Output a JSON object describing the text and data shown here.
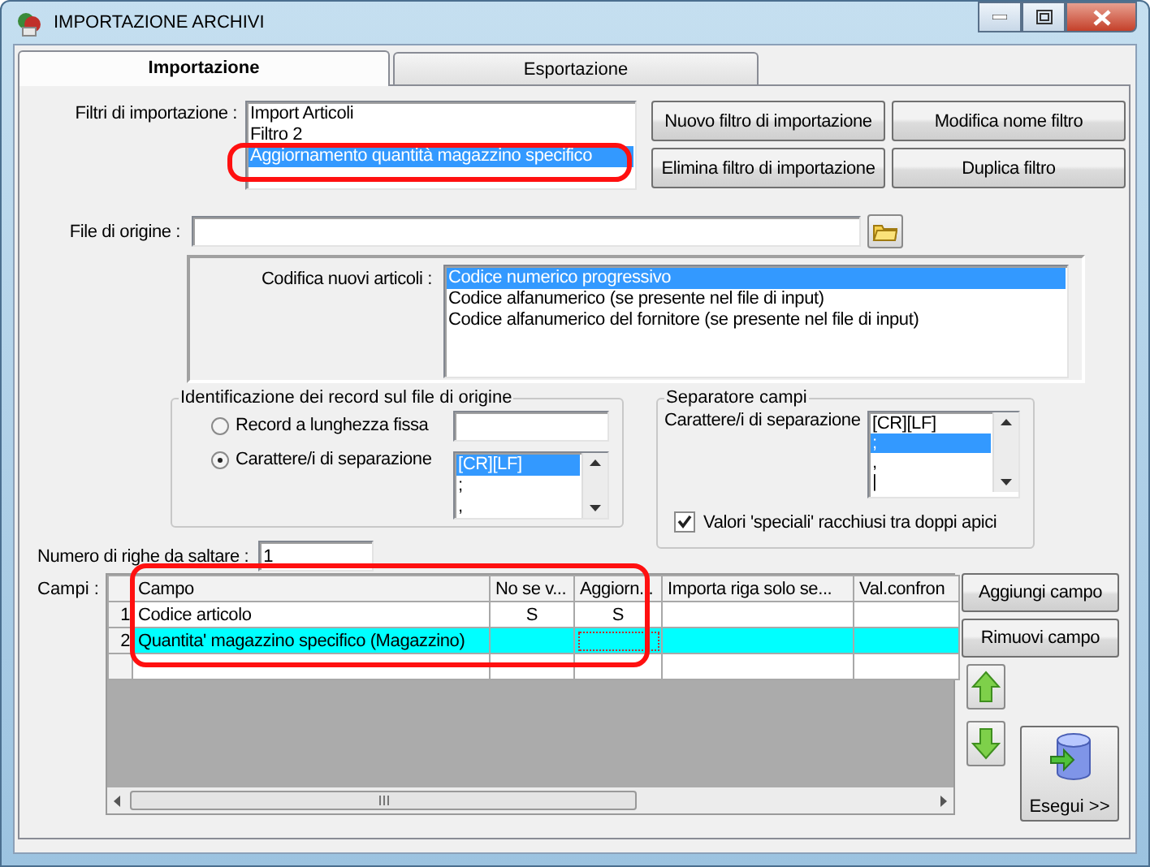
{
  "window": {
    "title": "IMPORTAZIONE ARCHIVI"
  },
  "tabs": [
    {
      "label": "Importazione",
      "selected": true
    },
    {
      "label": "Esportazione",
      "selected": false
    }
  ],
  "filters": {
    "label": "Filtri di importazione :",
    "highlighted": true,
    "items": [
      {
        "label": "Import Articoli",
        "selected": false
      },
      {
        "label": "Filtro 2",
        "selected": false
      },
      {
        "label": "Aggiornamento quantità magazzino specifico",
        "selected": true
      }
    ]
  },
  "filter_buttons": [
    "Nuovo filtro di importazione",
    "Modifica nome filtro",
    "Elimina filtro di importazione",
    "Duplica filtro"
  ],
  "source_file": {
    "label": "File di origine :"
  },
  "new_item_coding": {
    "label": "Codifica nuovi articoli :",
    "items": [
      {
        "label": "Codice numerico progressivo",
        "selected": true
      },
      {
        "label": "Codice alfanumerico (se presente nel file di input)",
        "selected": false
      },
      {
        "label": "Codice alfanumerico del fornitore (se presente nel file di input)",
        "selected": false
      }
    ]
  },
  "record_identification": {
    "title": "Identificazione dei record sul file di origine",
    "options": [
      {
        "label": "Record a lunghezza fissa",
        "selected": false
      },
      {
        "label": "Carattere/i di separazione",
        "selected": true
      }
    ],
    "separators": [
      {
        "label": "[CR][LF]",
        "selected": true
      },
      {
        "label": ";",
        "selected": false
      },
      {
        "label": ",",
        "selected": false
      }
    ]
  },
  "field_separator": {
    "title": "Separatore campi",
    "label": "Carattere/i di separazione",
    "items": [
      {
        "label": "[CR][LF]",
        "selected": false
      },
      {
        "label": ";",
        "selected": true
      },
      {
        "label": ",",
        "selected": false
      },
      {
        "label": "|",
        "selected": false
      }
    ],
    "quoted": {
      "label": "Valori 'speciali' racchiusi tra doppi apici",
      "checked": true
    }
  },
  "skip_rows": {
    "label": "Numero di righe da saltare  :",
    "value": "1"
  },
  "fields": {
    "label": "Campi :",
    "highlighted": true,
    "columns": [
      "Campo",
      "No se v...",
      "Aggiorn...",
      "Importa riga solo se...",
      "Val.confron"
    ],
    "rows": [
      {
        "header": "1",
        "selected": false,
        "cells": [
          {
            "text": "Codice articolo",
            "focused": false
          },
          {
            "text": "S",
            "focused": false
          },
          {
            "text": "S",
            "focused": false
          },
          {
            "focused": false
          },
          {
            "focused": false
          }
        ]
      },
      {
        "header": "2",
        "selected": true,
        "cells": [
          {
            "text": "Quantita' magazzino specifico (Magazzino)",
            "focused": false
          },
          {
            "focused": false
          },
          {
            "focused": true
          },
          {
            "focused": false
          },
          {
            "focused": false
          }
        ]
      },
      {
        "selected": false,
        "cells": [
          {
            "focused": false
          },
          {
            "focused": false
          },
          {
            "focused": false
          },
          {
            "focused": false
          },
          {
            "focused": false
          }
        ]
      }
    ]
  },
  "field_buttons": [
    "Aggiungi campo",
    "Rimuovi campo"
  ],
  "run_button": "Esegui >>"
}
